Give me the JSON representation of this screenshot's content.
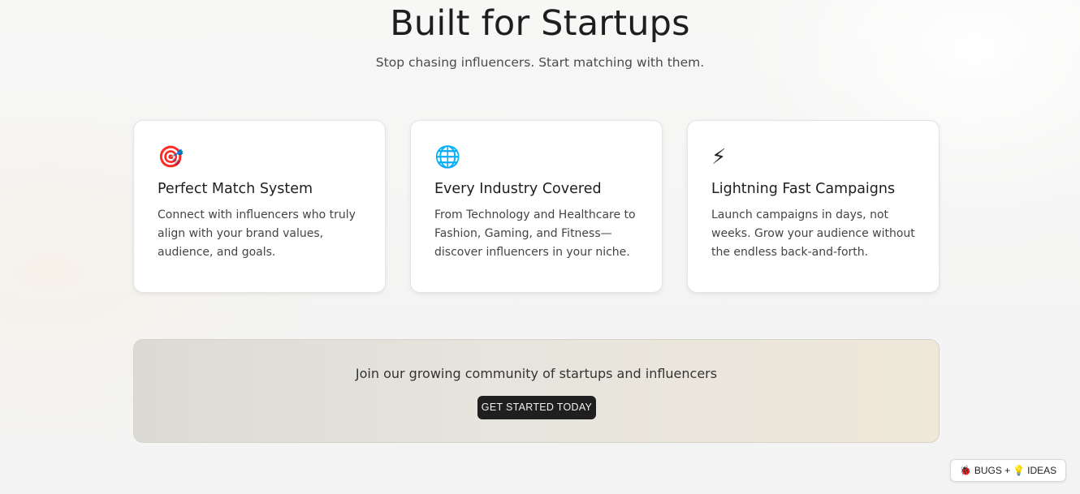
{
  "hero": {
    "title": "Built for Startups",
    "subtitle": "Stop chasing influencers. Start matching with them."
  },
  "features": [
    {
      "icon": "🎯",
      "icon_name": "target-icon",
      "title": "Perfect Match System",
      "description": "Connect with influencers who truly align with your brand values, audience, and goals."
    },
    {
      "icon": "🌐",
      "icon_name": "globe-icon",
      "title": "Every Industry Covered",
      "description": "From Technology and Healthcare to Fashion, Gaming, and Fitness—discover influencers in your niche."
    },
    {
      "icon": "⚡",
      "icon_name": "lightning-icon",
      "title": "Lightning Fast Campaigns",
      "description": "Launch campaigns in days, not weeks. Grow your audience without the endless back-and-forth."
    }
  ],
  "cta": {
    "text": "Join our growing community of startups and influencers",
    "button_label": "GET STARTED TODAY"
  },
  "feedback": {
    "bug_icon": "🐞",
    "bugs_label": "BUGS +",
    "idea_icon": "💡",
    "ideas_label": "IDEAS"
  },
  "colors": {
    "button_bg": "#1f1f1f",
    "card_bg": "#ffffff",
    "banner_start": "#dcdad4",
    "banner_end": "#efe8da"
  }
}
